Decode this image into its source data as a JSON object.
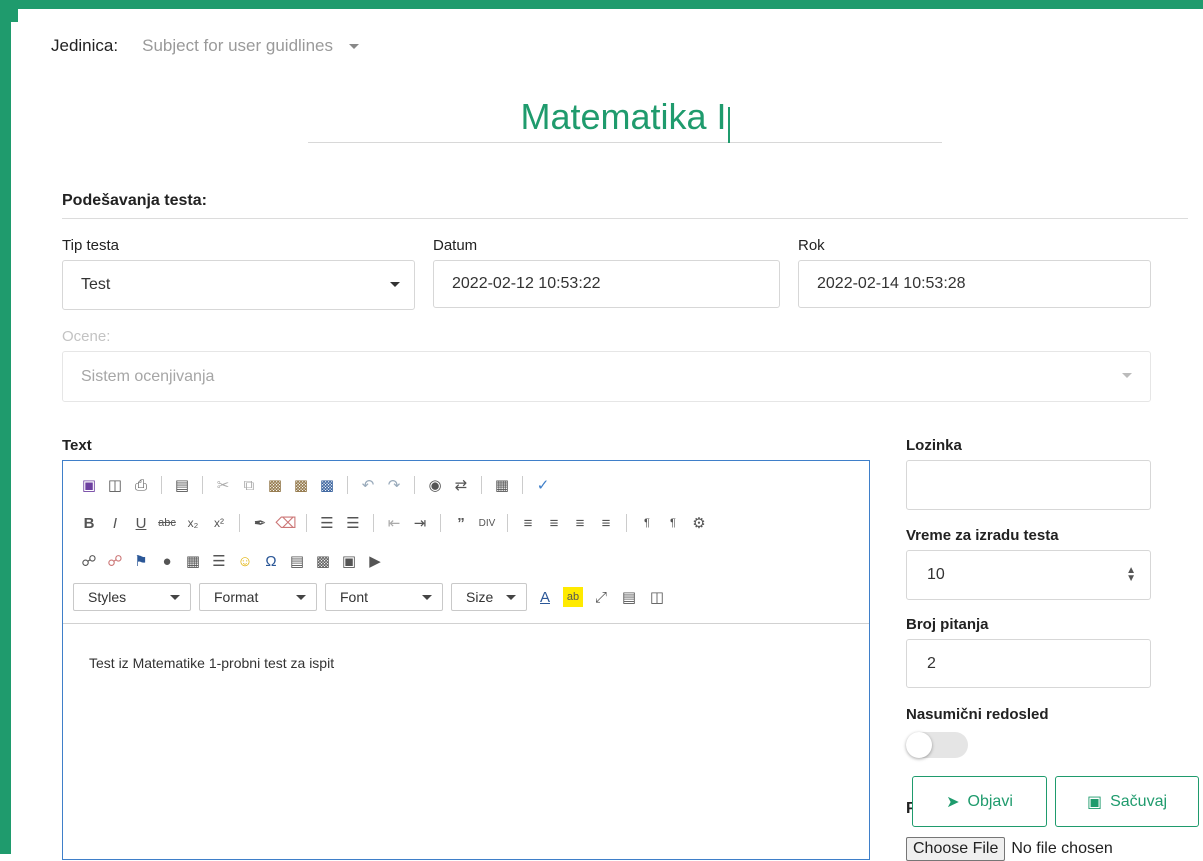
{
  "header": {
    "unit_label": "Jedinica:",
    "unit_value": "Subject for user guidlines"
  },
  "title": "Matematika I",
  "settings": {
    "section_title": "Podešavanja testa:",
    "test_type_label": "Tip testa",
    "test_type_value": "Test",
    "date_label": "Datum",
    "date_value": "2022-02-12 10:53:22",
    "deadline_label": "Rok",
    "deadline_value": "2022-02-14 10:53:28",
    "grades_label": "Ocene:",
    "grades_placeholder": "Sistem ocenjivanja"
  },
  "editor": {
    "label": "Text",
    "combos": [
      "Styles",
      "Format",
      "Font",
      "Size"
    ],
    "content": "Test iz Matematike 1-probni test za ispit"
  },
  "side": {
    "password_label": "Lozinka",
    "password_value": "",
    "time_label": "Vreme za izradu testa",
    "time_value": "10",
    "questions_label": "Broj pitanja",
    "questions_value": "2",
    "random_label": "Nasumični redosled",
    "random_on": false,
    "peek_letter": "P"
  },
  "buttons": {
    "publish": "Objavi",
    "save": "Sačuvaj"
  },
  "file": {
    "button": "Choose File",
    "status": "No file chosen"
  },
  "colors": {
    "brand": "#1f9b6d",
    "editor_focus": "#3f7fc9"
  }
}
